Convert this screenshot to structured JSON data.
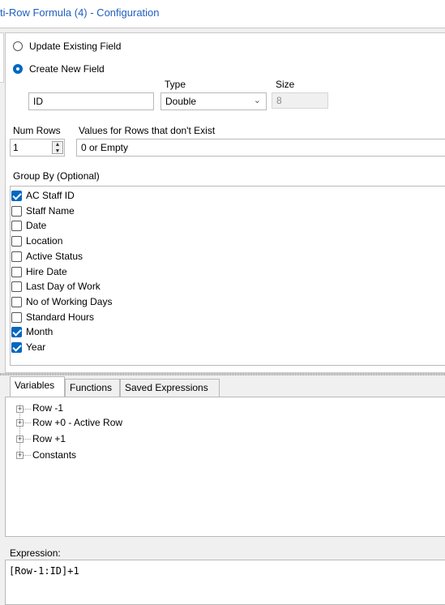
{
  "window": {
    "title": "ti-Row Formula (4) - Configuration"
  },
  "field_mode": {
    "update_existing_label": "Update Existing Field",
    "create_new_label": "Create New  Field",
    "selected": "create_new"
  },
  "new_field": {
    "name_value": "ID",
    "type_label": "Type",
    "type_value": "Double",
    "size_label": "Size",
    "size_value": "8"
  },
  "num_rows": {
    "label": "Num Rows",
    "value": "1"
  },
  "missing_rows": {
    "label": "Values for Rows that don't Exist",
    "value": "0 or Empty"
  },
  "group_by": {
    "label": "Group By (Optional)",
    "items": [
      {
        "label": "AC Staff ID",
        "checked": true
      },
      {
        "label": "Staff Name",
        "checked": false
      },
      {
        "label": "Date",
        "checked": false
      },
      {
        "label": "Location",
        "checked": false
      },
      {
        "label": "Active Status",
        "checked": false
      },
      {
        "label": "Hire Date",
        "checked": false
      },
      {
        "label": "Last Day of Work",
        "checked": false
      },
      {
        "label": "No of Working Days",
        "checked": false
      },
      {
        "label": "Standard Hours",
        "checked": false
      },
      {
        "label": "Month",
        "checked": true
      },
      {
        "label": "Year",
        "checked": true
      }
    ]
  },
  "tabs": [
    {
      "label": "Variables",
      "active": true
    },
    {
      "label": "Functions",
      "active": false
    },
    {
      "label": "Saved Expressions",
      "active": false
    }
  ],
  "tree": {
    "items": [
      {
        "label": "Row -1"
      },
      {
        "label": "Row +0 - Active Row"
      },
      {
        "label": "Row +1"
      },
      {
        "label": "Constants"
      }
    ]
  },
  "expression": {
    "label": "Expression:",
    "value": "[Row-1:ID]+1"
  },
  "colors": {
    "accent": "#0067c0",
    "title": "#1f5fbf"
  },
  "icons": {
    "combo_arrow": "chevron-down-icon",
    "spinner": "spinner-arrows-icon",
    "tree_expand": "plus-box-icon"
  }
}
